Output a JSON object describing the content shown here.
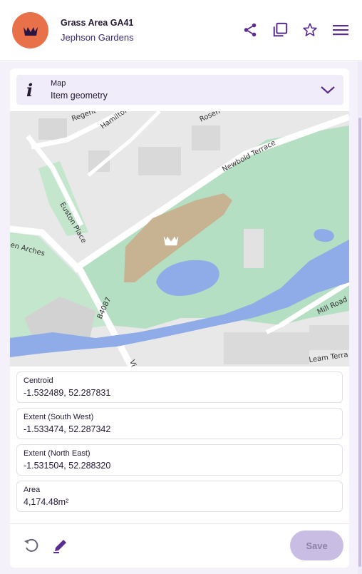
{
  "header": {
    "title": "Grass Area GA41",
    "subtitle": "Jephson Gardens",
    "avatar_color": "#e8714a",
    "actions": [
      "share-icon",
      "duplicate-icon",
      "star-icon",
      "menu-icon"
    ]
  },
  "accordion": {
    "label": "Map",
    "value": "Item geometry",
    "icon": "info-icon"
  },
  "map": {
    "street_labels": [
      "Regent",
      "Hamilton",
      "Rosen",
      "Newbold Terrace",
      "Euston Place",
      "en Arches",
      "B4087",
      "Vic",
      "Mill Road",
      "Leam Terra"
    ],
    "marker_icon": "crown-icon"
  },
  "fields": [
    {
      "label": "Centroid",
      "value": "-1.532489, 52.287831"
    },
    {
      "label": "Extent (South West)",
      "value": "-1.533474, 52.287342"
    },
    {
      "label": "Extent (North East)",
      "value": "-1.531504, 52.288320"
    },
    {
      "label": "Area",
      "value": "4,174.48m²"
    }
  ],
  "footer": {
    "undo_icon": "undo-icon",
    "edit_icon": "pencil-icon",
    "save_label": "Save"
  },
  "colors": {
    "accent": "#5a2d91",
    "save_disabled_bg": "#c9bde3",
    "park_green": "#b5dfc2",
    "water_blue": "#8fabe8",
    "polygon": "#c9ad8c"
  }
}
